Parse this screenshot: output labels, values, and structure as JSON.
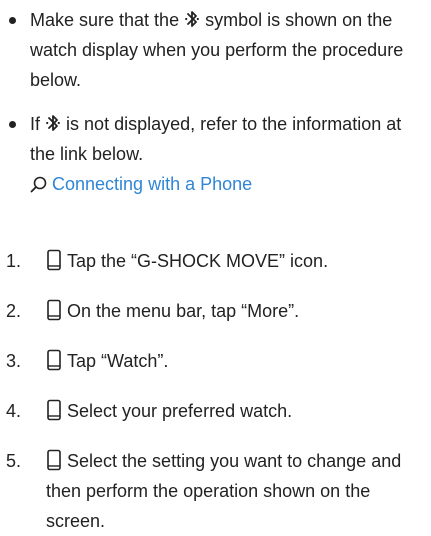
{
  "bullets": [
    {
      "before": "Make sure that the",
      "icon": "bluetooth-icon",
      "after": "symbol is shown on the watch display when you perform the procedure below."
    },
    {
      "before": "If",
      "icon": "bluetooth-icon",
      "after": "is not displayed, refer to the information at the link below.",
      "link_icon": "search-icon",
      "link_text": "Connecting with a Phone"
    }
  ],
  "steps": [
    {
      "number": "1.",
      "icon": "phone-icon",
      "text": "Tap the “G-SHOCK MOVE” icon."
    },
    {
      "number": "2.",
      "icon": "phone-icon",
      "text": "On the menu bar, tap “More”."
    },
    {
      "number": "3.",
      "icon": "phone-icon",
      "text": "Tap “Watch”."
    },
    {
      "number": "4.",
      "icon": "phone-icon",
      "text": "Select your preferred watch."
    },
    {
      "number": "5.",
      "icon": "phone-icon",
      "text": "Select the setting you want to change and then perform the operation shown on the screen."
    }
  ],
  "colors": {
    "text": "#222222",
    "link": "#2f86d6"
  }
}
